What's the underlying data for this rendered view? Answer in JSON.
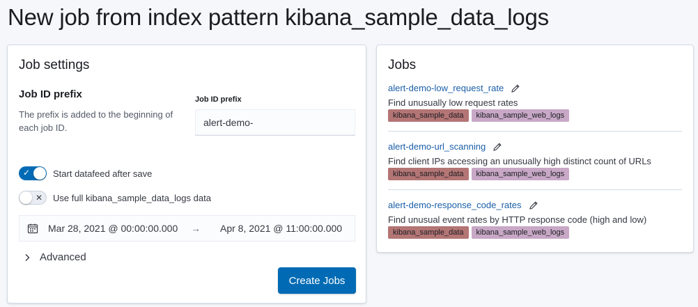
{
  "page": {
    "title": "New job from index pattern kibana_sample_data_logs"
  },
  "job_settings": {
    "title": "Job settings",
    "desc_title": "Job ID prefix",
    "desc_text": "The prefix is added to the beginning of each job ID.",
    "field_label": "Job ID prefix",
    "field_value": "alert-demo-",
    "start_datafeed": {
      "label": "Start datafeed after save",
      "checked": true
    },
    "use_full_data": {
      "label": "Use full kibana_sample_data_logs data",
      "checked": false
    },
    "date_range": {
      "start": "Mar 28, 2021 @ 00:00:00.000",
      "arrow": "→",
      "end": "Apr 8, 2021 @ 11:00:00.000"
    },
    "advanced_label": "Advanced",
    "create_button": "Create Jobs"
  },
  "jobs": {
    "title": "Jobs",
    "items": [
      {
        "name": "alert-demo-low_request_rate",
        "description": "Find unusually low request rates",
        "tags": [
          "kibana_sample_data",
          "kibana_sample_web_logs"
        ]
      },
      {
        "name": "alert-demo-url_scanning",
        "description": "Find client IPs accessing an unusually high distinct count of URLs",
        "tags": [
          "kibana_sample_data",
          "kibana_sample_web_logs"
        ]
      },
      {
        "name": "alert-demo-response_code_rates",
        "description": "Find unusual event rates by HTTP response code (high and low)",
        "tags": [
          "kibana_sample_data",
          "kibana_sample_web_logs"
        ]
      }
    ]
  },
  "colors": {
    "primary": "#006bb4",
    "link": "#1a5ea8",
    "tag_group_1": "#b47575",
    "tag_group_2": "#c8a8c6"
  },
  "icons": {
    "calendar": "calendar-icon",
    "chevron": "chevron-right-icon",
    "edit": "pencil-icon",
    "check": "check-icon",
    "cross": "cross-icon"
  }
}
